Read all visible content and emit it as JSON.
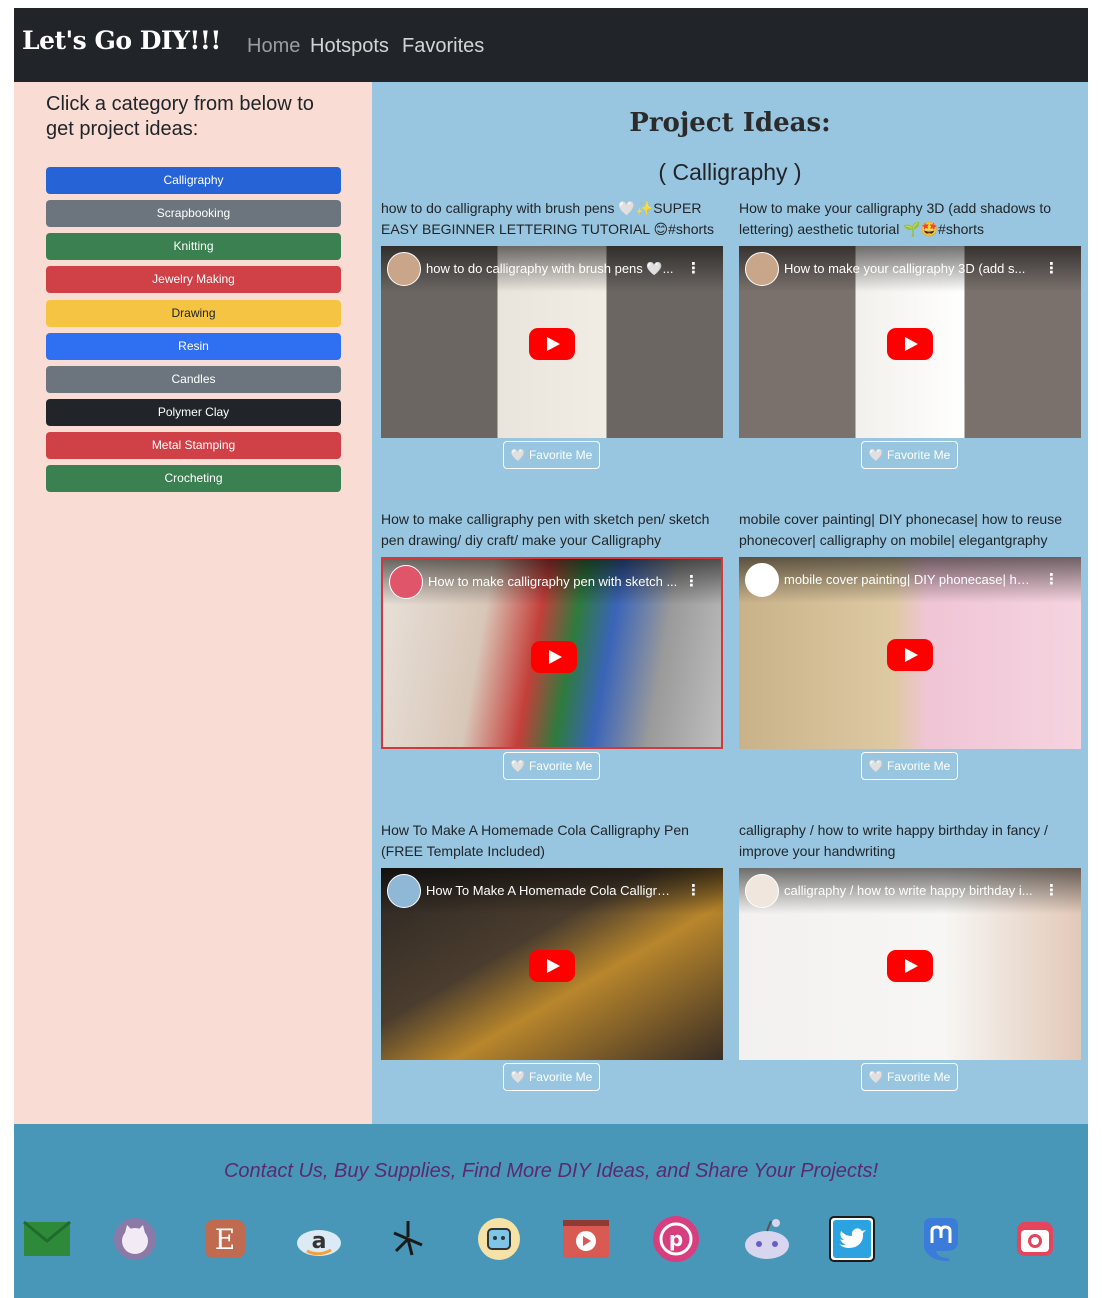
{
  "nav": {
    "brand": "Let's Go DIY!!!",
    "links": [
      "Home",
      "Hotspots",
      "Favorites"
    ]
  },
  "sidebar": {
    "heading": "Click a category from below to get project ideas:",
    "categories": [
      {
        "label": "Calligraphy",
        "color": "#2563d6"
      },
      {
        "label": "Scrapbooking",
        "color": "#6c757d"
      },
      {
        "label": "Knitting",
        "color": "#3a8050"
      },
      {
        "label": "Jewelry Making",
        "color": "#cf4047"
      },
      {
        "label": "Drawing",
        "color": "#f6c443"
      },
      {
        "label": "Resin",
        "color": "#2f6ff2"
      },
      {
        "label": "Candles",
        "color": "#6c757d"
      },
      {
        "label": "Polymer Clay",
        "color": "#212529"
      },
      {
        "label": "Metal Stamping",
        "color": "#cf4047"
      },
      {
        "label": "Crocheting",
        "color": "#3a8050"
      }
    ]
  },
  "main": {
    "title": "Project Ideas:",
    "subtitle": "( Calligraphy )",
    "fav_label": "🤍 Favorite Me",
    "cards": [
      {
        "title": "how to do calligraphy with brush pens 🤍✨SUPER EASY BEGINNER LETTERING TUTORIAL 😊#shorts",
        "video_title": "how to do calligraphy with brush pens 🤍..."
      },
      {
        "title": "How to make your calligraphy 3D (add shadows to lettering) aesthetic tutorial 🌱🤩#shorts",
        "video_title": "How to make your calligraphy 3D (add s..."
      },
      {
        "title": "How to make calligraphy pen with sketch pen/ sketch pen drawing/ diy craft/ make your Calligraphy",
        "video_title": "How to make calligraphy pen with sketch ..."
      },
      {
        "title": "mobile cover painting| DIY phonecase| how to reuse phonecover| calligraphy on mobile| elegantgraphy",
        "video_title": "mobile cover painting| DIY phonecase| ho..."
      },
      {
        "title": "How To Make A Homemade Cola Calligraphy Pen (FREE Template Included)",
        "video_title": "How To Make A Homemade Cola Calligrap..."
      },
      {
        "title": "calligraphy / how to write happy birthday in fancy / improve your handwriting",
        "video_title": "calligraphy / how to write happy birthday i..."
      }
    ]
  },
  "footer": {
    "text": "Contact Us, Buy Supplies, Find More DIY Ideas, and Share Your Projects!",
    "icons": [
      "mail-icon",
      "github-icon",
      "etsy-icon",
      "amazon-icon",
      "yelp-icon",
      "waze-icon",
      "youtube-icon",
      "pinterest-icon",
      "reddit-icon",
      "twitter-icon",
      "mastodon-icon",
      "instagram-icon"
    ]
  }
}
